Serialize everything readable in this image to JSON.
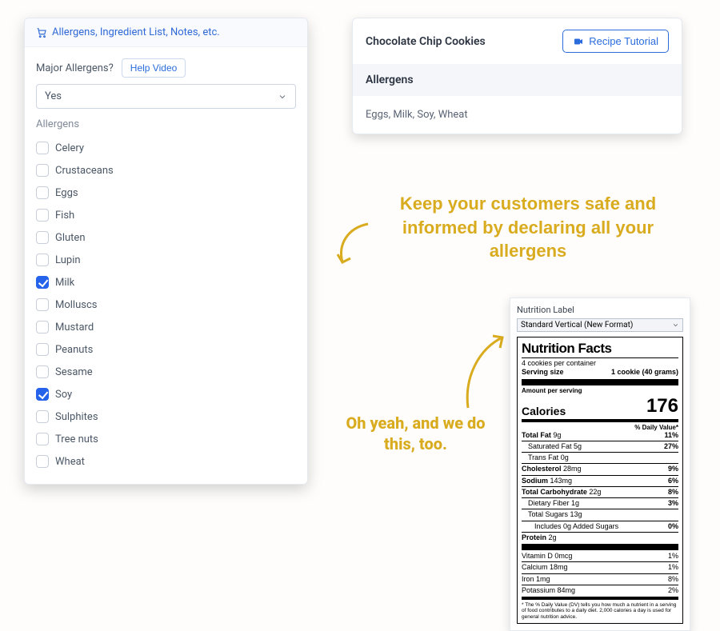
{
  "left_panel": {
    "header_label": "Allergens, Ingredient List, Notes, etc.",
    "major_allergens_label": "Major Allergens?",
    "help_button": "Help Video",
    "select_value": "Yes",
    "section_label": "Allergens",
    "allergens": [
      {
        "label": "Celery",
        "checked": false
      },
      {
        "label": "Crustaceans",
        "checked": false
      },
      {
        "label": "Eggs",
        "checked": false
      },
      {
        "label": "Fish",
        "checked": false
      },
      {
        "label": "Gluten",
        "checked": false
      },
      {
        "label": "Lupin",
        "checked": false
      },
      {
        "label": "Milk",
        "checked": true
      },
      {
        "label": "Molluscs",
        "checked": false
      },
      {
        "label": "Mustard",
        "checked": false
      },
      {
        "label": "Peanuts",
        "checked": false
      },
      {
        "label": "Sesame",
        "checked": false
      },
      {
        "label": "Soy",
        "checked": true
      },
      {
        "label": "Sulphites",
        "checked": false
      },
      {
        "label": "Tree nuts",
        "checked": false
      },
      {
        "label": "Wheat",
        "checked": false
      }
    ]
  },
  "recipe_card": {
    "title": "Chocolate Chip Cookies",
    "tutorial_button": "Recipe Tutorial",
    "allergens_heading": "Allergens",
    "allergens_list": "Eggs, Milk, Soy, Wheat"
  },
  "callouts": {
    "main": "Keep your customers safe and informed by declaring all your allergens",
    "secondary": "Oh yeah, and we do this, too."
  },
  "nutrition": {
    "panel_title": "Nutrition Label",
    "format_select": "Standard Vertical (New Format)",
    "facts_heading": "Nutrition Facts",
    "servings_per_container": "4 cookies per container",
    "serving_size_label": "Serving size",
    "serving_size_value": "1 cookie (40 grams)",
    "amount_per_serving": "Amount per serving",
    "calories_label": "Calories",
    "calories_value": "176",
    "dv_header": "% Daily Value*",
    "rows": [
      {
        "name": "Total Fat",
        "amount": "9g",
        "dv": "11%",
        "bold": true,
        "indent": 0
      },
      {
        "name": "Saturated Fat",
        "amount": "5g",
        "dv": "27%",
        "bold": false,
        "indent": 1
      },
      {
        "name": "Trans Fat",
        "amount": "0g",
        "dv": "",
        "bold": false,
        "indent": 1
      },
      {
        "name": "Cholesterol",
        "amount": "28mg",
        "dv": "9%",
        "bold": true,
        "indent": 0
      },
      {
        "name": "Sodium",
        "amount": "143mg",
        "dv": "6%",
        "bold": true,
        "indent": 0
      },
      {
        "name": "Total Carbohydrate",
        "amount": "22g",
        "dv": "8%",
        "bold": true,
        "indent": 0
      },
      {
        "name": "Dietary Fiber",
        "amount": "1g",
        "dv": "3%",
        "bold": false,
        "indent": 1
      },
      {
        "name": "Total Sugars",
        "amount": "13g",
        "dv": "",
        "bold": false,
        "indent": 1
      },
      {
        "name": "Includes 0g Added Sugars",
        "amount": "",
        "dv": "0%",
        "bold": false,
        "indent": 2
      },
      {
        "name": "Protein",
        "amount": "2g",
        "dv": "",
        "bold": true,
        "indent": 0
      }
    ],
    "micros": [
      {
        "name": "Vitamin D",
        "amount": "0mcg",
        "dv": "1%"
      },
      {
        "name": "Calcium",
        "amount": "18mg",
        "dv": "1%"
      },
      {
        "name": "Iron",
        "amount": "1mg",
        "dv": "8%"
      },
      {
        "name": "Potassium",
        "amount": "84mg",
        "dv": "2%"
      }
    ],
    "fineprint": "* The % Daily Value (DV) tells you how much a nutrient in a serving of food contributes to a daily diet. 2,000 calories a day is used for general nutrition advice."
  }
}
